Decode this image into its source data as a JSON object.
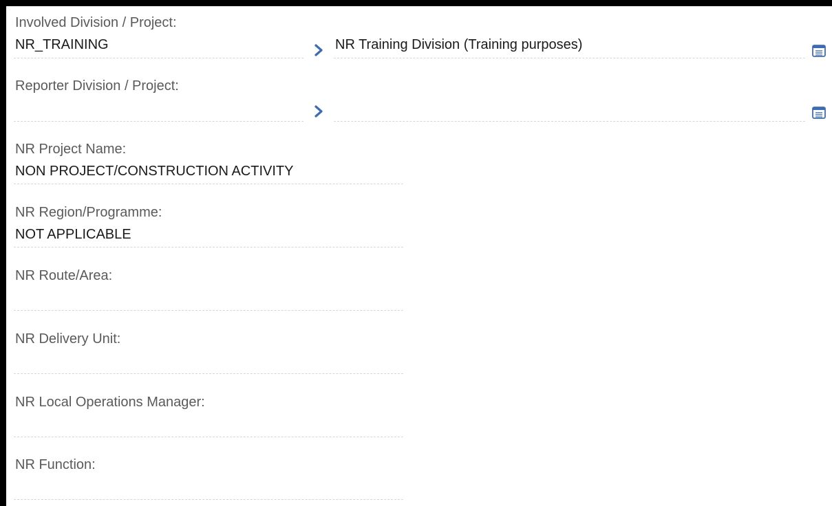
{
  "form": {
    "involved": {
      "label": "Involved Division / Project:",
      "code": "NR_TRAINING",
      "description": "NR Training Division (Training purposes)"
    },
    "reporter": {
      "label": "Reporter Division / Project:",
      "code": "",
      "description": ""
    },
    "project_name": {
      "label": "NR Project Name:",
      "value": "NON PROJECT/CONSTRUCTION ACTIVITY"
    },
    "region": {
      "label": "NR Region/Programme:",
      "value": "NOT APPLICABLE"
    },
    "route": {
      "label": "NR Route/Area:",
      "value": ""
    },
    "delivery_unit": {
      "label": "NR Delivery Unit:",
      "value": ""
    },
    "local_ops_manager": {
      "label": "NR Local Operations Manager:",
      "value": ""
    },
    "function": {
      "label": "NR Function:",
      "value": ""
    }
  },
  "icons": {
    "chevron": "chevron-right-icon",
    "lookup": "list-lookup-icon"
  },
  "colors": {
    "accent": "#3d6cb3",
    "label": "#5a5a5a",
    "value": "#1a1a1a",
    "divider": "#d6d6d6"
  }
}
